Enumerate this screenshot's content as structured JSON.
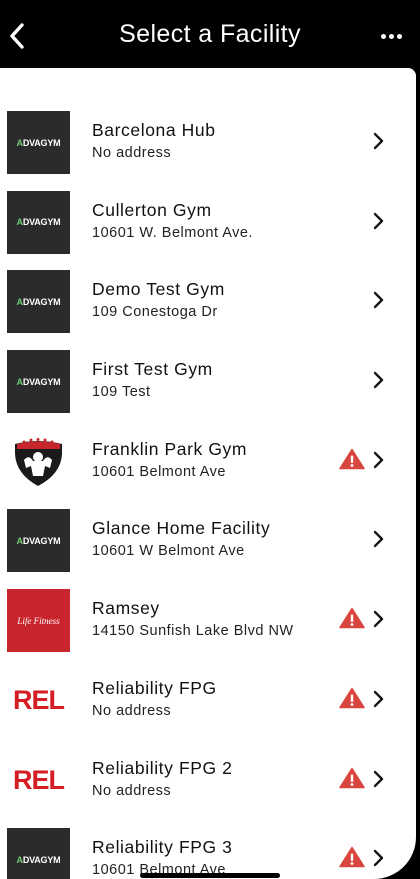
{
  "header": {
    "title": "Select a Facility",
    "back_icon": "chevron-left-icon",
    "more_icon": "more-horizontal-icon"
  },
  "facilities": [
    {
      "name": "Barcelona Hub",
      "address": "No address",
      "logo": "advagym",
      "logo_text": "ADVAGYM",
      "warning": false
    },
    {
      "name": "Cullerton Gym",
      "address": "10601 W. Belmont Ave.",
      "logo": "advagym",
      "logo_text": "ADVAGYM",
      "warning": false
    },
    {
      "name": "Demo Test Gym",
      "address": "109 Conestoga Dr",
      "logo": "advagym",
      "logo_text": "ADVAGYM",
      "warning": false
    },
    {
      "name": "First Test Gym",
      "address": "109 Test",
      "logo": "advagym",
      "logo_text": "ADVAGYM",
      "warning": false
    },
    {
      "name": "Franklin Park Gym",
      "address": "10601 Belmont Ave",
      "logo": "bodybuilder",
      "logo_text": "",
      "warning": true
    },
    {
      "name": "Glance Home Facility",
      "address": "10601 W Belmont Ave",
      "logo": "advagym",
      "logo_text": "ADVAGYM",
      "warning": false
    },
    {
      "name": "Ramsey",
      "address": " 14150 Sunfish Lake Blvd NW",
      "logo": "lifefitness",
      "logo_text": "Life Fitness",
      "warning": true
    },
    {
      "name": "Reliability FPG",
      "address": "No address",
      "logo": "rel",
      "logo_text": "REL",
      "warning": true
    },
    {
      "name": "Reliability FPG 2",
      "address": "No address",
      "logo": "rel",
      "logo_text": "REL",
      "warning": true
    },
    {
      "name": "Reliability FPG 3",
      "address": "10601 Belmont Ave",
      "logo": "advagym",
      "logo_text": "ADVAGYM",
      "warning": true
    }
  ],
  "colors": {
    "header_bg": "#000000",
    "warning": "#d9463f",
    "advagym_bg": "#2b2b2d",
    "lifefitness_bg": "#c8262c",
    "rel_red": "#d41f26"
  }
}
